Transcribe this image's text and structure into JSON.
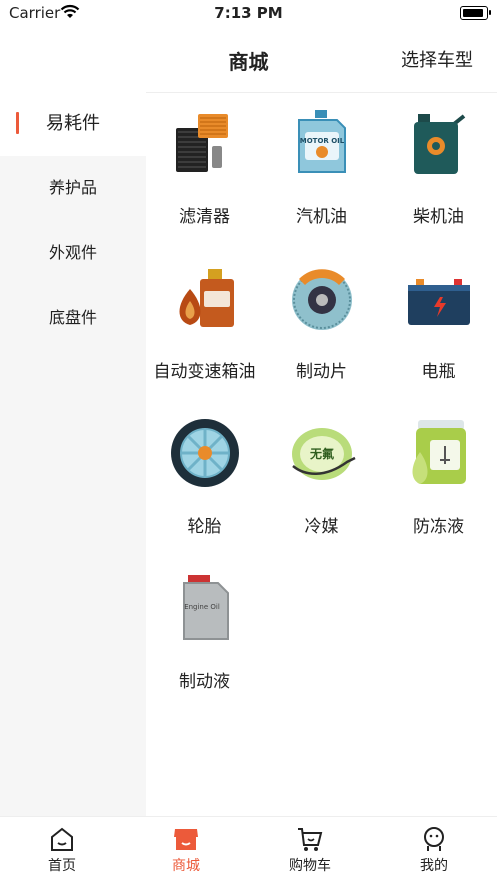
{
  "status_bar": {
    "carrier": "Carrier",
    "time": "7:13 PM"
  },
  "nav": {
    "title": "商城",
    "right_action": "选择车型"
  },
  "sidebar": {
    "items": [
      {
        "label": "易耗件"
      },
      {
        "label": "养护品"
      },
      {
        "label": "外观件"
      },
      {
        "label": "底盘件"
      }
    ],
    "active_index": 0
  },
  "products": [
    {
      "label": "滤清器",
      "icon": "air-filter-icon"
    },
    {
      "label": "汽机油",
      "icon": "motor-oil-icon",
      "icon_text": "MOTOR OIL"
    },
    {
      "label": "柴机油",
      "icon": "diesel-oil-icon"
    },
    {
      "label": "自动变速箱油",
      "icon": "transmission-oil-icon"
    },
    {
      "label": "制动片",
      "icon": "brake-pad-icon"
    },
    {
      "label": "电瓶",
      "icon": "battery-icon"
    },
    {
      "label": "轮胎",
      "icon": "tire-icon"
    },
    {
      "label": "冷媒",
      "icon": "refrigerant-icon",
      "icon_text": "无氟"
    },
    {
      "label": "防冻液",
      "icon": "antifreeze-icon"
    },
    {
      "label": "制动液",
      "icon": "brake-fluid-icon",
      "icon_text": "Engine Oil"
    }
  ],
  "tabbar": {
    "items": [
      {
        "label": "首页",
        "icon": "home-icon"
      },
      {
        "label": "商城",
        "icon": "store-icon"
      },
      {
        "label": "购物车",
        "icon": "cart-icon"
      },
      {
        "label": "我的",
        "icon": "profile-icon"
      }
    ],
    "active_index": 1
  },
  "colors": {
    "accent": "#ec5a3a",
    "sidebar_bg": "#f6f6f6"
  }
}
